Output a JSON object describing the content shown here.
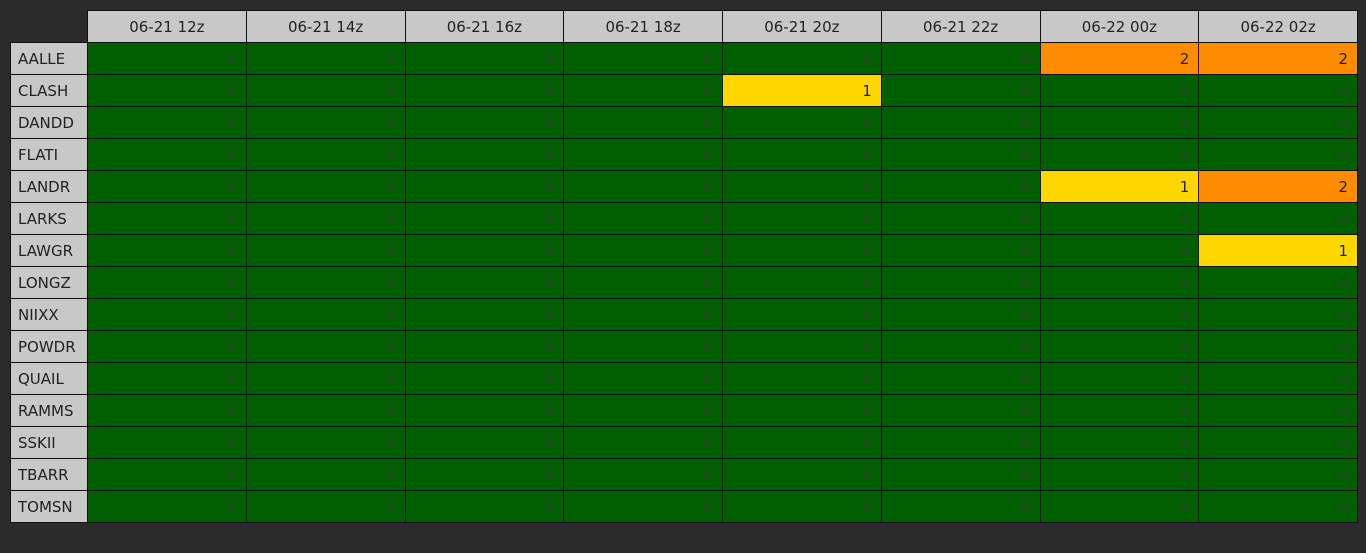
{
  "colors": {
    "level_0": "#005f00",
    "level_1": "#ffd700",
    "level_2": "#ff8c00",
    "header_bg": "#c8c8c8",
    "page_bg": "#2b2b2b"
  },
  "columns": [
    "06-21 12z",
    "06-21 14z",
    "06-21 16z",
    "06-21 18z",
    "06-21 20z",
    "06-21 22z",
    "06-22 00z",
    "06-22 02z"
  ],
  "rows": [
    {
      "name": "AALLE",
      "values": [
        0,
        0,
        0,
        0,
        0,
        0,
        2,
        2
      ]
    },
    {
      "name": "CLASH",
      "values": [
        0,
        0,
        0,
        0,
        1,
        0,
        0,
        0
      ]
    },
    {
      "name": "DANDD",
      "values": [
        0,
        0,
        0,
        0,
        0,
        0,
        0,
        0
      ]
    },
    {
      "name": "FLATI",
      "values": [
        0,
        0,
        0,
        0,
        0,
        0,
        0,
        0
      ]
    },
    {
      "name": "LANDR",
      "values": [
        0,
        0,
        0,
        0,
        0,
        0,
        1,
        2
      ]
    },
    {
      "name": "LARKS",
      "values": [
        0,
        0,
        0,
        0,
        0,
        0,
        0,
        0
      ]
    },
    {
      "name": "LAWGR",
      "values": [
        0,
        0,
        0,
        0,
        0,
        0,
        0,
        1
      ]
    },
    {
      "name": "LONGZ",
      "values": [
        0,
        0,
        0,
        0,
        0,
        0,
        0,
        0
      ]
    },
    {
      "name": "NIIXX",
      "values": [
        0,
        0,
        0,
        0,
        0,
        0,
        0,
        0
      ]
    },
    {
      "name": "POWDR",
      "values": [
        0,
        0,
        0,
        0,
        0,
        0,
        0,
        0
      ]
    },
    {
      "name": "QUAIL",
      "values": [
        0,
        0,
        0,
        0,
        0,
        0,
        0,
        0
      ]
    },
    {
      "name": "RAMMS",
      "values": [
        0,
        0,
        0,
        0,
        0,
        0,
        0,
        0
      ]
    },
    {
      "name": "SSKII",
      "values": [
        0,
        0,
        0,
        0,
        0,
        0,
        0,
        0
      ]
    },
    {
      "name": "TBARR",
      "values": [
        0,
        0,
        0,
        0,
        0,
        0,
        0,
        0
      ]
    },
    {
      "name": "TOMSN",
      "values": [
        0,
        0,
        0,
        0,
        0,
        0,
        0,
        0
      ]
    }
  ]
}
